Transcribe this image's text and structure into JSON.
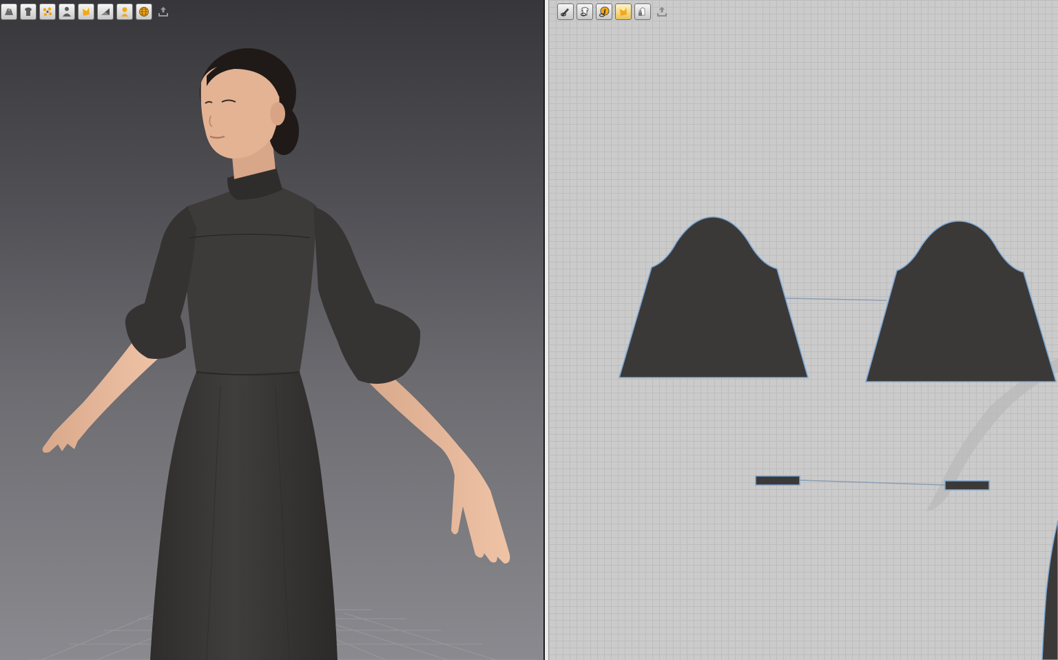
{
  "colors": {
    "fabric": "#3b3938",
    "pattern_outline": "#7aa8d6",
    "sewing_line": "#8a9db5",
    "skin": "#e2b497",
    "hair": "#1f1a17",
    "accent_yellow": "#f2a81d"
  },
  "toolbar_3d": {
    "tools": [
      {
        "icon": "avatar-cloth-icon"
      },
      {
        "icon": "garment-icon"
      },
      {
        "icon": "arrangement-points-icon"
      },
      {
        "icon": "avatar-display-icon"
      },
      {
        "icon": "texture-icon"
      },
      {
        "icon": "surface-icon"
      },
      {
        "icon": "avatar-skin-icon"
      },
      {
        "icon": "globe-icon"
      },
      {
        "icon": "export-icon"
      }
    ]
  },
  "toolbar_2d": {
    "tools": [
      {
        "icon": "show-pattern-icon"
      },
      {
        "icon": "pattern-view-icon"
      },
      {
        "icon": "info-icon"
      },
      {
        "icon": "texture-2d-icon"
      },
      {
        "icon": "lock-pattern-icon"
      },
      {
        "icon": "export-2d-icon"
      }
    ]
  }
}
